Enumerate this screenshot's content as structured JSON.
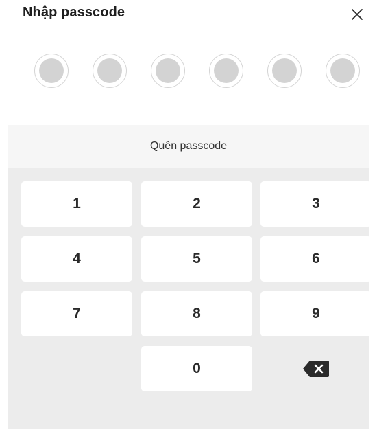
{
  "header": {
    "title": "Nhập passcode",
    "close_icon": "close-icon"
  },
  "passcode": {
    "length": 6,
    "filled": 0
  },
  "forgot": {
    "label": "Quên passcode"
  },
  "keypad": {
    "keys": [
      "1",
      "2",
      "3",
      "4",
      "5",
      "6",
      "7",
      "8",
      "9",
      "0"
    ],
    "backspace_icon": "backspace-icon"
  },
  "colors": {
    "keypad_bg": "#ececec",
    "key_bg": "#ffffff",
    "dot_fill": "#d3d3d3",
    "text": "#222222"
  }
}
